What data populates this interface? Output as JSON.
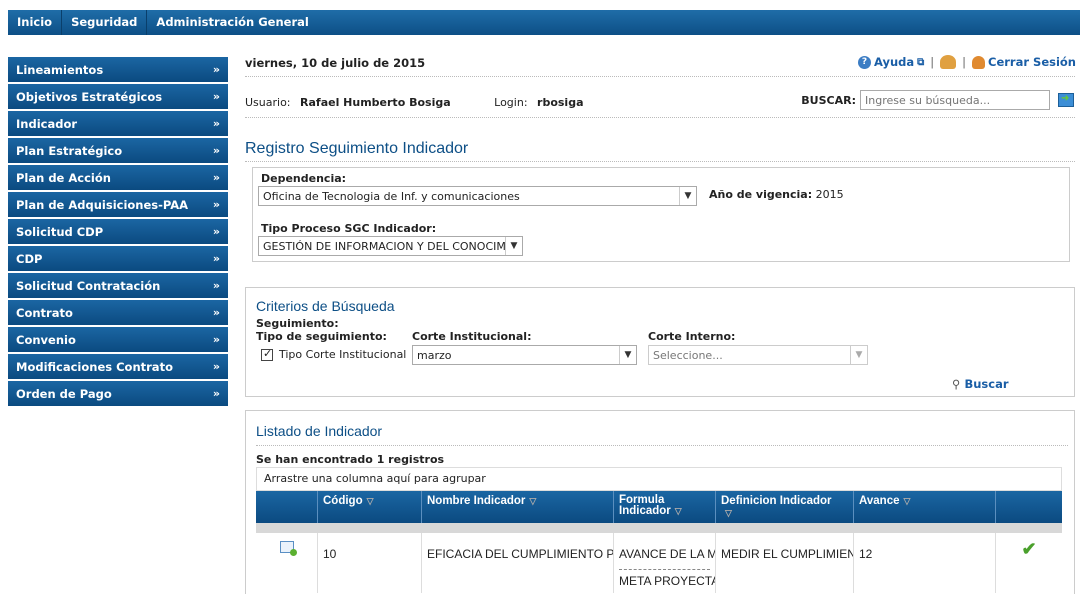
{
  "topnav": {
    "items": [
      "Inicio",
      "Seguridad",
      "Administración General"
    ]
  },
  "sidebar": {
    "items": [
      "Lineamientos",
      "Objetivos Estratégicos",
      "Indicador",
      "Plan Estratégico",
      "Plan de Acción",
      "Plan de Adquisiciones-PAA",
      "Solicitud CDP",
      "CDP",
      "Solicitud Contratación",
      "Contrato",
      "Convenio",
      "Modificaciones Contrato",
      "Orden de Pago"
    ]
  },
  "header": {
    "date": "viernes, 10 de julio de 2015",
    "help_label": "Ayuda",
    "logout_label": "Cerrar Sesión",
    "user_label": "Usuario:",
    "user_name": "Rafael Humberto Bosiga",
    "login_label": "Login:",
    "login_value": "rbosiga",
    "search_label": "BUSCAR:",
    "search_placeholder": "Ingrese su búsqueda..."
  },
  "main": {
    "title": "Registro Seguimiento Indicador",
    "dependencia_label": "Dependencia:",
    "dependencia_value": "Oficina de Tecnologia de Inf. y comunicaciones",
    "vigencia_label": "Año de vigencia:",
    "vigencia_value": "2015",
    "tipo_proceso_label": "Tipo Proceso SGC Indicador:",
    "tipo_proceso_value": "GESTIÓN DE INFORMACION Y DEL CONOCIM"
  },
  "criterios": {
    "title": "Criterios de Búsqueda",
    "seguimiento_label": "Seguimiento:",
    "tipo_seguimiento_label": "Tipo de seguimiento:",
    "tipo_corte_label": "Tipo Corte Institucional",
    "corte_institucional_label": "Corte Institucional:",
    "corte_institucional_value": "marzo",
    "corte_interno_label": "Corte Interno:",
    "corte_interno_value": "Seleccione...",
    "buscar_label": "Buscar"
  },
  "listado": {
    "title": "Listado de Indicador",
    "count_text": "Se han encontrado 1 registros",
    "group_hint": "Arrastre una columna aquí para agrupar",
    "columns": [
      "Código",
      "Nombre Indicador",
      "Formula Indicador",
      "Definicion Indicador",
      "Avance"
    ],
    "rows": [
      {
        "codigo": "10",
        "nombre": "EFICACIA DEL CUMPLIMIENTO PE",
        "formula_top": "AVANCE DE LA M",
        "formula_bottom": "META PROYECTA",
        "definicion": "MEDIR EL CUMPLIMIENT",
        "avance": "12"
      }
    ]
  }
}
